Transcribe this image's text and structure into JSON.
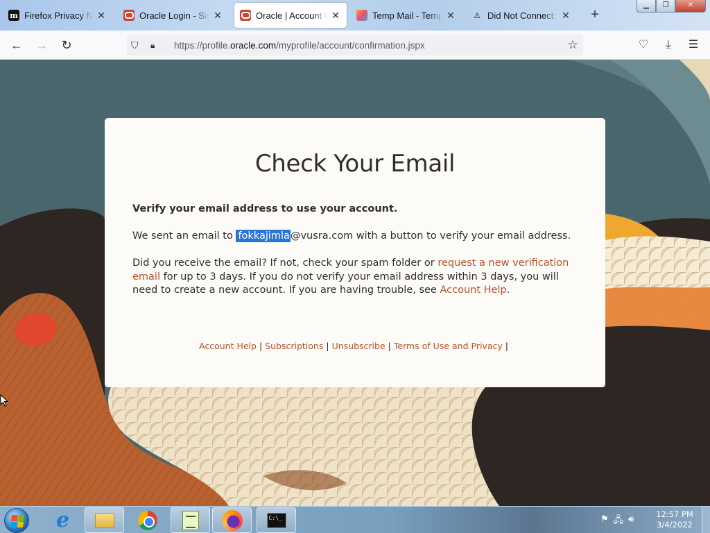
{
  "browser": {
    "tabs": [
      {
        "title": "Firefox Privacy Notice",
        "icon": "mozilla-m-icon",
        "active": false
      },
      {
        "title": "Oracle Login - Single Sign On",
        "icon": "oracle-icon",
        "active": false
      },
      {
        "title": "Oracle | Account Confirmation",
        "icon": "oracle-icon",
        "active": true
      },
      {
        "title": "Temp Mail - Temporary Email",
        "icon": "tempmail-icon",
        "active": false
      },
      {
        "title": "Did Not Connect: Potential Security Issue",
        "icon": "warning-icon",
        "active": false
      }
    ],
    "new_tab_symbol": "+",
    "window_controls": {
      "minimize": "▁",
      "restore": "❐",
      "close": "✕"
    },
    "url_prefix": "https://profile.",
    "url_domain": "oracle.com",
    "url_path": "/myprofile/account/confirmation.jspx"
  },
  "content": {
    "heading": "Check Your Email",
    "verify_text": "Verify your email address to use your account.",
    "sent_prefix": "We sent an email to ",
    "email_selected": "fokkajimla",
    "email_rest": "@vusra.com",
    "sent_suffix": " with a button to verify your email address.",
    "received_prefix": "Did you receive the email? If not, check your spam folder or ",
    "request_link": "request a new verification email",
    "received_middle": " for up to 3 days. If you do not verify your email address within 3 days, you will need to create a new account. If you are having trouble, see ",
    "account_help_link": "Account Help",
    "received_end": ".",
    "footer_links": {
      "account_help": "Account Help",
      "subscriptions": "Subscriptions",
      "unsubscribe": "Unsubscribe",
      "terms": "Terms of Use and Privacy"
    },
    "footer_separator": "|"
  },
  "taskbar": {
    "time": "12:57 PM",
    "date": "3/4/2022"
  },
  "colors": {
    "link": "#b5522a",
    "selection": "#2a75d6",
    "card_bg": "#fcfbf8",
    "text": "#312d2a"
  }
}
